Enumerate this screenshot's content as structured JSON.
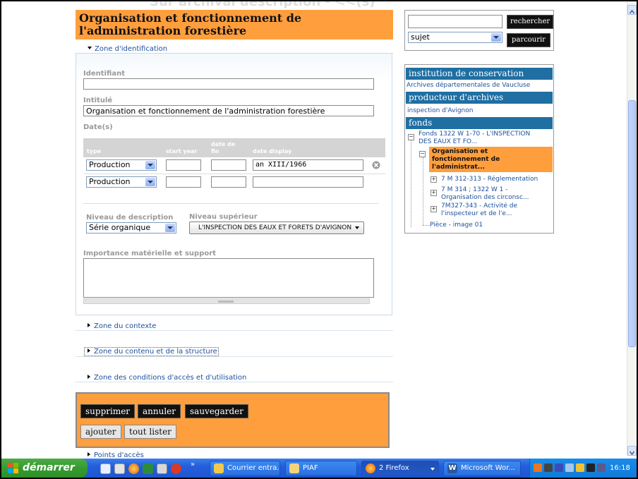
{
  "page": {
    "ghost_title": "Sur archival description - &lt;&lt;(s)",
    "title": "Organisation et fonctionnement de l'administration forestière"
  },
  "ident": {
    "zone_label": "Zone d'identification",
    "identifiant_label": "Identifiant",
    "identifiant_value": "",
    "intitule_label": "Intitulé",
    "intitule_value": "Organisation et fonctionnement de l'administration forestière",
    "dates_label": "Date(s)",
    "dates_columns": {
      "type": "type",
      "start_year": "start year",
      "end_line1": "date de",
      "end_line2": "fin",
      "display": "date display"
    },
    "dates_rows": [
      {
        "type": "Production",
        "start_year": "",
        "end_year": "",
        "display": "an XIII/1966"
      },
      {
        "type": "Production",
        "start_year": "",
        "end_year": "",
        "display": ""
      }
    ],
    "niveau_label": "Niveau de description",
    "niveau_value": "Série organique",
    "niveau_sup_label": "Niveau supérieur",
    "niveau_sup_value": "L'INSPECTION DES EAUX ET FORETS D'AVIGNON",
    "importance_label": "Importance matérielle et support",
    "importance_value": ""
  },
  "zones": {
    "contexte": "Zone du contexte",
    "contenu": "Zone du contenu et de la structure",
    "conditions": "Zone des conditions d'accès et d'utilisation",
    "points": "Points d'accès"
  },
  "actions": {
    "supprimer": "supprimer",
    "annuler": "annuler",
    "sauvegarder": "sauvegarder",
    "ajouter": "ajouter",
    "tout_lister": "tout lister"
  },
  "search": {
    "input_value": "",
    "rechercher": "rechercher",
    "select_value": "sujet",
    "parcourir": "parcourir"
  },
  "context_panel": {
    "institution_heading": "institution de conservation",
    "institution_link": "Archives départementales de Vaucluse",
    "producteur_heading": "producteur d'archives",
    "producteur_link": "inspection d'Avignon",
    "fonds_heading": "fonds",
    "tree": {
      "root_line1": "Fonds 1322 W 1-70 - L'INSPECTION",
      "root_line2": "DES EAUX ET FO...",
      "current_line1": "Organisation et",
      "current_line2": "fonctionnement de",
      "current_line3": "l'administrat...",
      "child1": "7 M 312-313 - Réglementation",
      "child2_line1": "7 M 314 ; 1322 W 1 -",
      "child2_line2": "Organisation des circonsc...",
      "child3_line1": "7M327-343 - Activité de",
      "child3_line2": "l'inspecteur et de l'e...",
      "piece": "Pièce - image 01"
    }
  },
  "taskbar": {
    "start": "démarrer",
    "items": [
      "Courrier entra...",
      "PIAF",
      "2 Firefox",
      "Microsoft Wor..."
    ],
    "clock": "16:18"
  },
  "colors": {
    "accent_orange": "#ff9e3d",
    "heading_blue": "#1f6fa3",
    "link_blue": "#1c4f9c",
    "taskbar_blue": "#245edb",
    "start_green": "#379a31"
  },
  "icons": [
    "close-circle-icon",
    "dropdown-arrow-icon",
    "tree-expand-icon",
    "tree-collapse-icon",
    "windows-flag-icon",
    "firefox-icon",
    "word-icon",
    "folder-icon",
    "outlook-icon"
  ]
}
